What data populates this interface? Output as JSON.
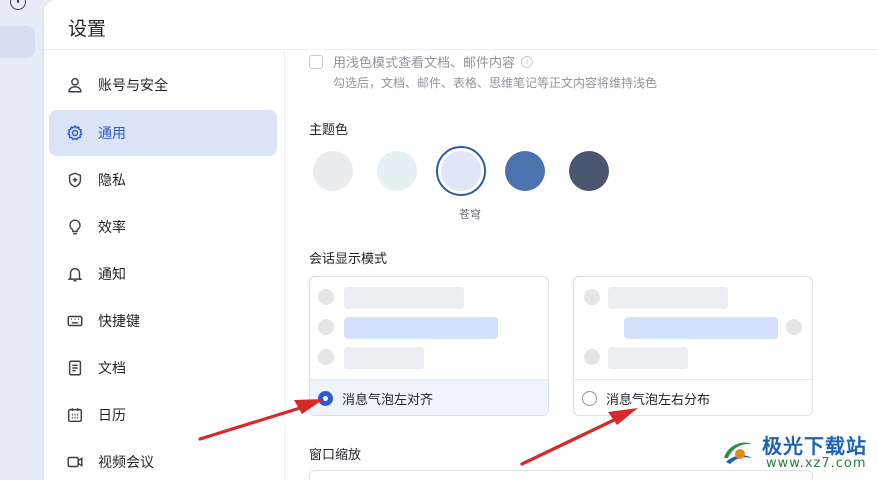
{
  "window": {
    "title": "设置"
  },
  "sidebar": {
    "items": [
      {
        "label": "账号与安全",
        "icon": "user-icon"
      },
      {
        "label": "通用",
        "icon": "gear-icon",
        "active": true
      },
      {
        "label": "隐私",
        "icon": "shield-icon"
      },
      {
        "label": "效率",
        "icon": "lightbulb-icon"
      },
      {
        "label": "通知",
        "icon": "bell-icon"
      },
      {
        "label": "快捷键",
        "icon": "keyboard-icon"
      },
      {
        "label": "文档",
        "icon": "document-icon"
      },
      {
        "label": "日历",
        "icon": "calendar-icon"
      },
      {
        "label": "视频会议",
        "icon": "video-icon"
      }
    ]
  },
  "content": {
    "light_mode_checkbox": {
      "label": "用浅色模式查看文档、邮件内容",
      "checked": false,
      "hint": "勾选后，文档、邮件、表格、思维笔记等正文内容将维持浅色"
    },
    "theme": {
      "label": "主题色",
      "swatches": [
        {
          "color": "#ebecee"
        },
        {
          "color": "#e5f0f2"
        },
        {
          "color": "#dfe6f8",
          "selected": true,
          "name": "苍穹"
        },
        {
          "color": "#4b73ad"
        },
        {
          "color": "#4a5570"
        }
      ]
    },
    "chat_mode": {
      "label": "会话显示模式",
      "options": [
        {
          "label": "消息气泡左对齐",
          "selected": true
        },
        {
          "label": "消息气泡左右分布",
          "selected": false
        }
      ]
    },
    "zoom": {
      "label": "窗口缩放"
    }
  },
  "colors": {
    "accent": "#2e5bd0",
    "arrow": "#d42a2a"
  },
  "watermark": {
    "name": "极光下载站",
    "url": "www.xz7.com"
  }
}
